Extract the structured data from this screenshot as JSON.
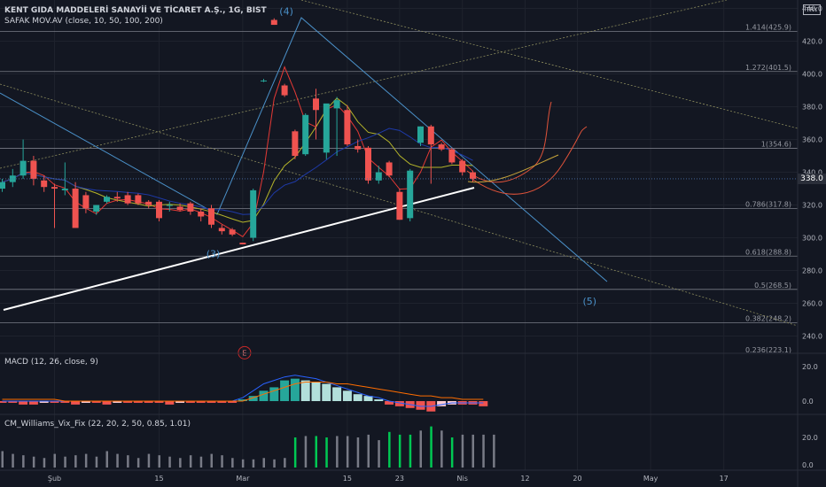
{
  "header": {
    "title": "KENT GIDA MADDELERİ SANAYİİ VE TİCARET A.Ş., 1G, BIST",
    "indicator": "SAFAK MOV.AV (close, 10, 50, 100, 200)",
    "currency": "TRY",
    "last_price": "338.0"
  },
  "macd_legend": "MACD (12, 26, close, 9)",
  "vix_legend": "CM_Williams_Vix_Fix (22, 20, 2, 50, 0.85, 1.01)",
  "colors": {
    "up": "#26a69a",
    "down": "#ef5350",
    "background": "#131722",
    "macd_line": "#2962ff",
    "signal_line": "#ff6d00"
  },
  "chart_data": {
    "type": "candlestick",
    "title": "KENT GIDA MADDELERİ SANAYİİ VE TİCARET A.Ş., 1G, BIST",
    "xlabel": "",
    "ylabel": "",
    "x_ticks": [
      {
        "label": "Şub",
        "i": 5
      },
      {
        "label": "15",
        "i": 15
      },
      {
        "label": "Mar",
        "i": 23
      },
      {
        "label": "15",
        "i": 33
      },
      {
        "label": "23",
        "i": 38
      },
      {
        "label": "Nis",
        "i": 44
      },
      {
        "label": "12",
        "i": 50
      },
      {
        "label": "20",
        "i": 55
      },
      {
        "label": "May",
        "i": 62
      },
      {
        "label": "17",
        "i": 69
      }
    ],
    "ylim": [
      223,
      441
    ],
    "y_ticks": [
      240,
      260,
      280,
      300,
      320,
      340,
      360,
      380,
      400,
      420,
      440
    ],
    "candles": [
      {
        "o": 330,
        "h": 336,
        "l": 328,
        "c": 334
      },
      {
        "o": 334,
        "h": 342,
        "l": 331,
        "c": 338
      },
      {
        "o": 338,
        "h": 360,
        "l": 336,
        "c": 347
      },
      {
        "o": 347,
        "h": 350,
        "l": 332,
        "c": 336
      },
      {
        "o": 335,
        "h": 338,
        "l": 328,
        "c": 331
      },
      {
        "o": 331,
        "h": 333,
        "l": 306,
        "c": 330
      },
      {
        "o": 329,
        "h": 346,
        "l": 326,
        "c": 330
      },
      {
        "o": 330,
        "h": 334,
        "l": 312,
        "c": 306
      },
      {
        "o": 326,
        "h": 328,
        "l": 315,
        "c": 318
      },
      {
        "o": 316,
        "h": 320,
        "l": 314,
        "c": 320
      },
      {
        "o": 322,
        "h": 326,
        "l": 321,
        "c": 325
      },
      {
        "o": 325,
        "h": 328,
        "l": 322,
        "c": 324
      },
      {
        "o": 326,
        "h": 328,
        "l": 320,
        "c": 321
      },
      {
        "o": 326,
        "h": 327,
        "l": 320,
        "c": 321
      },
      {
        "o": 322,
        "h": 323,
        "l": 318,
        "c": 320
      },
      {
        "o": 322,
        "h": 323,
        "l": 310,
        "c": 312
      },
      {
        "o": 320,
        "h": 322,
        "l": 316,
        "c": 320
      },
      {
        "o": 319,
        "h": 321,
        "l": 316,
        "c": 317
      },
      {
        "o": 321,
        "h": 322,
        "l": 314,
        "c": 316
      },
      {
        "o": 316,
        "h": 318,
        "l": 310,
        "c": 313
      },
      {
        "o": 318,
        "h": 320,
        "l": 306,
        "c": 308
      },
      {
        "o": 306,
        "h": 308,
        "l": 302,
        "c": 304
      },
      {
        "o": 305,
        "h": 306,
        "l": 301,
        "c": 302
      },
      {
        "o": 297,
        "h": 297,
        "l": 296,
        "c": 296
      },
      {
        "o": 300,
        "h": 330,
        "l": 298,
        "c": 329
      },
      {
        "o": 396,
        "h": 397,
        "l": 395,
        "c": 396
      },
      {
        "o": 433,
        "h": 434,
        "l": 430,
        "c": 430
      },
      {
        "o": 393,
        "h": 394,
        "l": 386,
        "c": 387
      },
      {
        "o": 365,
        "h": 366,
        "l": 348,
        "c": 350
      },
      {
        "o": 351,
        "h": 376,
        "l": 350,
        "c": 375
      },
      {
        "o": 385,
        "h": 391,
        "l": 360,
        "c": 378
      },
      {
        "o": 352,
        "h": 381,
        "l": 348,
        "c": 382
      },
      {
        "o": 379,
        "h": 386,
        "l": 350,
        "c": 384
      },
      {
        "o": 378,
        "h": 381,
        "l": 356,
        "c": 357
      },
      {
        "o": 356,
        "h": 360,
        "l": 352,
        "c": 354
      },
      {
        "o": 355,
        "h": 356,
        "l": 333,
        "c": 335
      },
      {
        "o": 335,
        "h": 344,
        "l": 333,
        "c": 340
      },
      {
        "o": 346,
        "h": 347,
        "l": 337,
        "c": 338
      },
      {
        "o": 328,
        "h": 330,
        "l": 311,
        "c": 311
      },
      {
        "o": 312,
        "h": 342,
        "l": 310,
        "c": 341
      },
      {
        "o": 358,
        "h": 368,
        "l": 356,
        "c": 368
      },
      {
        "o": 368,
        "h": 369,
        "l": 333,
        "c": 357
      },
      {
        "o": 357,
        "h": 358,
        "l": 353,
        "c": 354
      },
      {
        "o": 354,
        "h": 355,
        "l": 345,
        "c": 346
      },
      {
        "o": 347,
        "h": 348,
        "l": 338,
        "c": 340
      },
      {
        "o": 340,
        "h": 341,
        "l": 334,
        "c": 336
      }
    ],
    "fib_levels": [
      {
        "label": "1.414(425.9)",
        "value": 425.9
      },
      {
        "label": "1.272(401.5)",
        "value": 401.5
      },
      {
        "label": "1(354.6)",
        "value": 354.6
      },
      {
        "label": "0.786(317.8)",
        "value": 317.8
      },
      {
        "label": "0.618(288.8)",
        "value": 288.8
      },
      {
        "label": "0.5(268.5)",
        "value": 268.5
      },
      {
        "label": "0.382(248.2)",
        "value": 248.2
      },
      {
        "label": "0.236(223.1)",
        "value": 223.1
      }
    ],
    "wave_labels": [
      {
        "label": "(4)",
        "i": 27,
        "v": 440
      },
      {
        "label": "(3)",
        "i": 20,
        "v": 292
      },
      {
        "label": "(5)",
        "i": 56,
        "v": 263
      },
      {
        "label": "E",
        "i": 23,
        "v": 232
      }
    ],
    "macd": {
      "y_ticks": [
        0.0,
        20.0
      ],
      "ylim": [
        -8,
        24
      ],
      "hist": [
        -1,
        -1,
        -2,
        -2,
        -1,
        -1,
        -1,
        -2,
        -1,
        -1,
        -2,
        -1,
        -1,
        -1,
        -1,
        -1,
        -2,
        -1,
        -1,
        -1,
        -1,
        -1,
        -1,
        1,
        3,
        6,
        8,
        12,
        13,
        12,
        11,
        10,
        8,
        6,
        4,
        3,
        1,
        -2,
        -3,
        -4,
        -5,
        -6,
        -3,
        -2,
        -2,
        -2,
        -3
      ],
      "macd_line": [
        0,
        0,
        0,
        0,
        0,
        0,
        0,
        0,
        0,
        0,
        0,
        0,
        0,
        0,
        0,
        0,
        0,
        0,
        0,
        0,
        0,
        0,
        0,
        2,
        6,
        10,
        12,
        14,
        15,
        14,
        13,
        11,
        9,
        7,
        5,
        3,
        2,
        0,
        -1,
        -2,
        -3,
        -3,
        -2,
        -1,
        -1,
        -1,
        -1
      ],
      "signal_line": [
        1,
        1,
        1,
        1,
        1,
        1,
        0,
        0,
        0,
        0,
        0,
        0,
        0,
        0,
        0,
        0,
        0,
        0,
        0,
        0,
        0,
        0,
        0,
        0,
        2,
        4,
        6,
        8,
        10,
        11,
        11,
        11,
        10,
        10,
        9,
        8,
        7,
        6,
        5,
        4,
        3,
        3,
        2,
        2,
        1,
        1,
        1
      ]
    },
    "vix": {
      "y_ticks": [
        0.0,
        20.0
      ],
      "ylim": [
        -3,
        30
      ],
      "bars": [
        10,
        8,
        7,
        6,
        5,
        8,
        6,
        7,
        8,
        6,
        10,
        8,
        7,
        5,
        8,
        7,
        6,
        5,
        7,
        6,
        8,
        7,
        5,
        4,
        4,
        5,
        4,
        5,
        20,
        21,
        21,
        20,
        21,
        21,
        20,
        22,
        18,
        24,
        22,
        22,
        25,
        28,
        25,
        20,
        22,
        22,
        22,
        22
      ],
      "highlight": [
        0,
        0,
        0,
        0,
        0,
        0,
        0,
        0,
        0,
        0,
        0,
        0,
        0,
        0,
        0,
        0,
        0,
        0,
        0,
        0,
        0,
        0,
        0,
        0,
        0,
        0,
        0,
        0,
        1,
        0,
        1,
        1,
        0,
        0,
        0,
        0,
        0,
        1,
        1,
        1,
        0,
        1,
        0,
        1,
        0,
        0,
        0,
        0
      ]
    }
  }
}
